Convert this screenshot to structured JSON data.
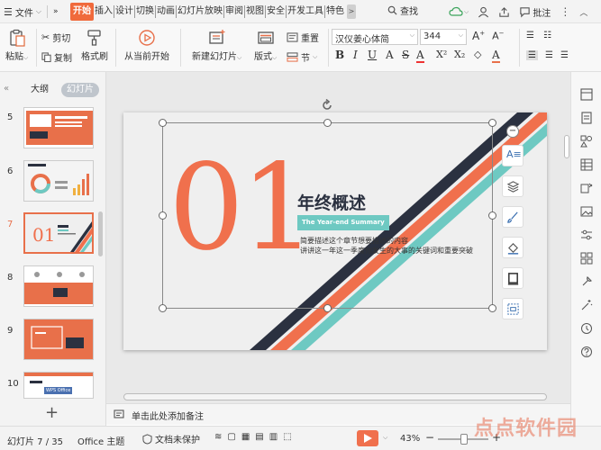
{
  "top": {
    "file": "文件",
    "tabs": [
      "开始",
      "插入",
      "设计",
      "切换",
      "动画",
      "幻灯片放映",
      "审阅",
      "视图",
      "安全",
      "开发工具",
      "特色"
    ],
    "more": ">",
    "search": "查找",
    "comment": "批注"
  },
  "ribbon": {
    "paste": "粘贴",
    "cut": "剪切",
    "copy": "复制",
    "format_painter": "格式刷",
    "play_from_current": "从当前开始",
    "new_slide": "新建幻灯片",
    "layout": "版式",
    "reset": "重置",
    "section": "节",
    "font_name": "汉仪姜心体简",
    "font_size": "344"
  },
  "panel": {
    "outline_tab": "大纲",
    "slides_tab": "幻灯片",
    "slide_numbers": [
      "5",
      "6",
      "7",
      "8",
      "9",
      "10"
    ],
    "slide10_text": "WPS Office",
    "add": "+"
  },
  "slide": {
    "big_number": "01",
    "title": "年终概述",
    "subtitle": "The Year-end Summary",
    "line1": "简要描述这个章节想要描述的内容",
    "line2": "讲讲这一年这一季度你发生的大事的关键词和重要突破"
  },
  "notes": {
    "placeholder": "单击此处添加备注"
  },
  "status": {
    "slide_count": "幻灯片 7 / 35",
    "theme": "Office 主题",
    "protect": "文档未保护",
    "zoom": "43%",
    "zoom_minus": "−",
    "zoom_plus": "+"
  },
  "watermark": "点点软件园",
  "colors": {
    "accent": "#f06a3c",
    "coral": "#f0704d",
    "teal": "#6ec9c2",
    "navy": "#2b3140"
  }
}
